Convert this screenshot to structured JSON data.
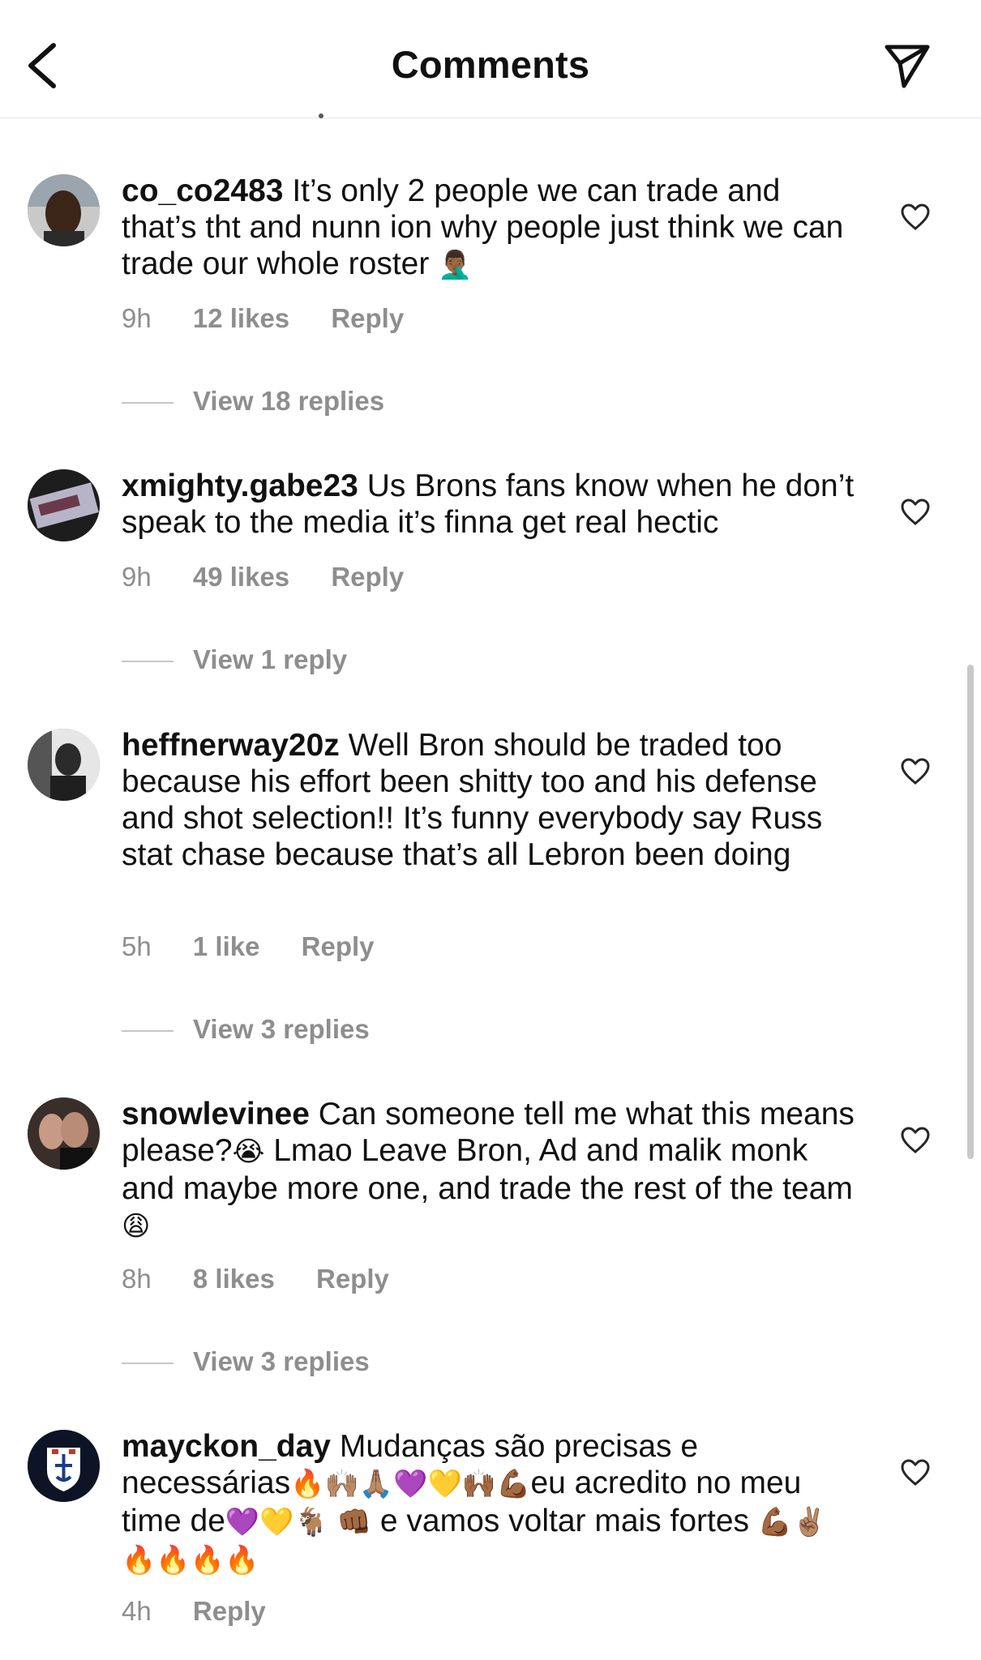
{
  "header": {
    "title": "Comments"
  },
  "comments": [
    {
      "username": "co_co2483",
      "text": "It’s only 2 people we can trade and that’s tht and nunn ion why people just think we can trade our whole roster",
      "emojis": "🤦🏾‍♂️",
      "time": "9h",
      "likes": "12 likes",
      "reply": "Reply",
      "view_replies": "View 18 replies"
    },
    {
      "username": "xmighty.gabe23",
      "text": "Us Brons fans know when he don’t speak to the media it’s finna get real hectic",
      "time": "9h",
      "likes": "49 likes",
      "reply": "Reply",
      "view_replies": "View 1 reply"
    },
    {
      "username": "heffnerway20z",
      "text": "Well Bron should be traded too because his effort been shitty too and his defense and shot selection!! It’s funny everybody say Russ stat chase because that’s all Lebron been doing",
      "time": "5h",
      "likes": "1 like",
      "reply": "Reply",
      "view_replies": "View 3 replies"
    },
    {
      "username": "snowlevinee",
      "text_a": "Can someone tell me what this means please?",
      "emoji_a": "😭",
      "text_b": " Lmao Leave Bron, Ad and malik monk and maybe more one, and trade the rest of the team ",
      "emoji_b": "😩",
      "time": "8h",
      "likes": "8 likes",
      "reply": "Reply",
      "view_replies": "View 3 replies"
    },
    {
      "username": "mayckon_day",
      "text_a": "Mudanças são precisas e necessárias",
      "emoji_a": "🔥🙌🏽🙏🏽💜💛🙌🏾💪🏾",
      "text_b": "eu acredito no meu time de",
      "emoji_b": "💜💛🐐 👊🏾",
      "text_c": " e vamos voltar mais fortes ",
      "emoji_c": "💪🏾✌🏽🔥🔥🔥🔥",
      "time": "4h",
      "reply": "Reply"
    }
  ],
  "colors": {
    "meta": "#8e8e8e",
    "text": "#111111",
    "divider": "#e6e6e6"
  }
}
